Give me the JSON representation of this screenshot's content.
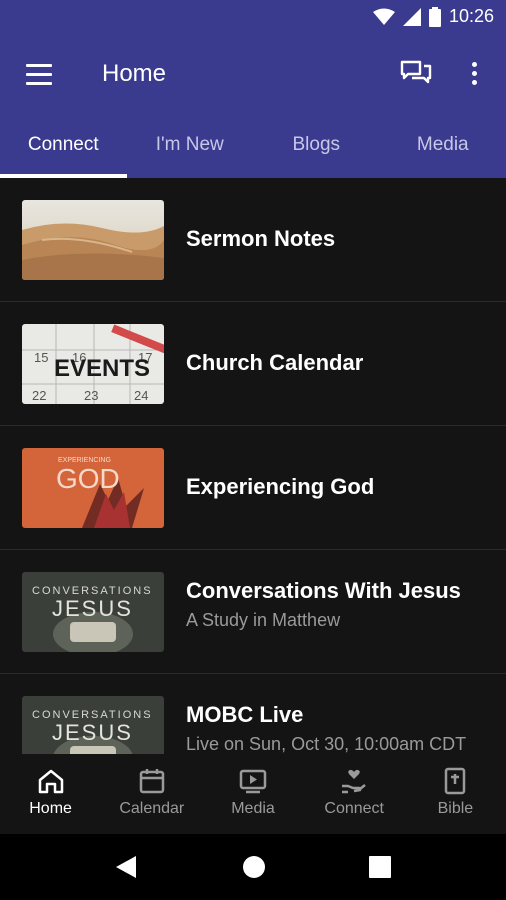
{
  "status_bar": {
    "time": "10:26"
  },
  "app_bar": {
    "title": "Home"
  },
  "tabs": [
    {
      "label": "Connect",
      "active": true
    },
    {
      "label": "I'm New",
      "active": false
    },
    {
      "label": "Blogs",
      "active": false
    },
    {
      "label": "Media",
      "active": false
    }
  ],
  "list": [
    {
      "title": "Sermon Notes",
      "subtitle": ""
    },
    {
      "title": "Church Calendar",
      "subtitle": "",
      "thumb_text": "EVENTS",
      "thumb_numbers": [
        "15",
        "16",
        "17",
        "22",
        "23",
        "24"
      ]
    },
    {
      "title": "Experiencing God",
      "subtitle": "",
      "thumb_text": "EXPERIENCING",
      "thumb_text2": "GOD"
    },
    {
      "title": "Conversations With Jesus",
      "subtitle": "A Study in Matthew",
      "thumb_text": "CONVERSATIONS",
      "thumb_text2": "JESUS"
    },
    {
      "title": "MOBC Live",
      "subtitle": "Live on Sun, Oct 30, 10:00am CDT",
      "thumb_text": "CONVERSATIONS",
      "thumb_text2": "JESUS"
    }
  ],
  "bottom_nav": [
    {
      "label": "Home",
      "icon": "home-icon",
      "active": true
    },
    {
      "label": "Calendar",
      "icon": "calendar-icon",
      "active": false
    },
    {
      "label": "Media",
      "icon": "media-icon",
      "active": false
    },
    {
      "label": "Connect",
      "icon": "connect-icon",
      "active": false
    },
    {
      "label": "Bible",
      "icon": "bible-icon",
      "active": false
    }
  ],
  "colors": {
    "primary": "#3a3a8f",
    "background": "#141414",
    "muted": "#9a9a9a"
  }
}
